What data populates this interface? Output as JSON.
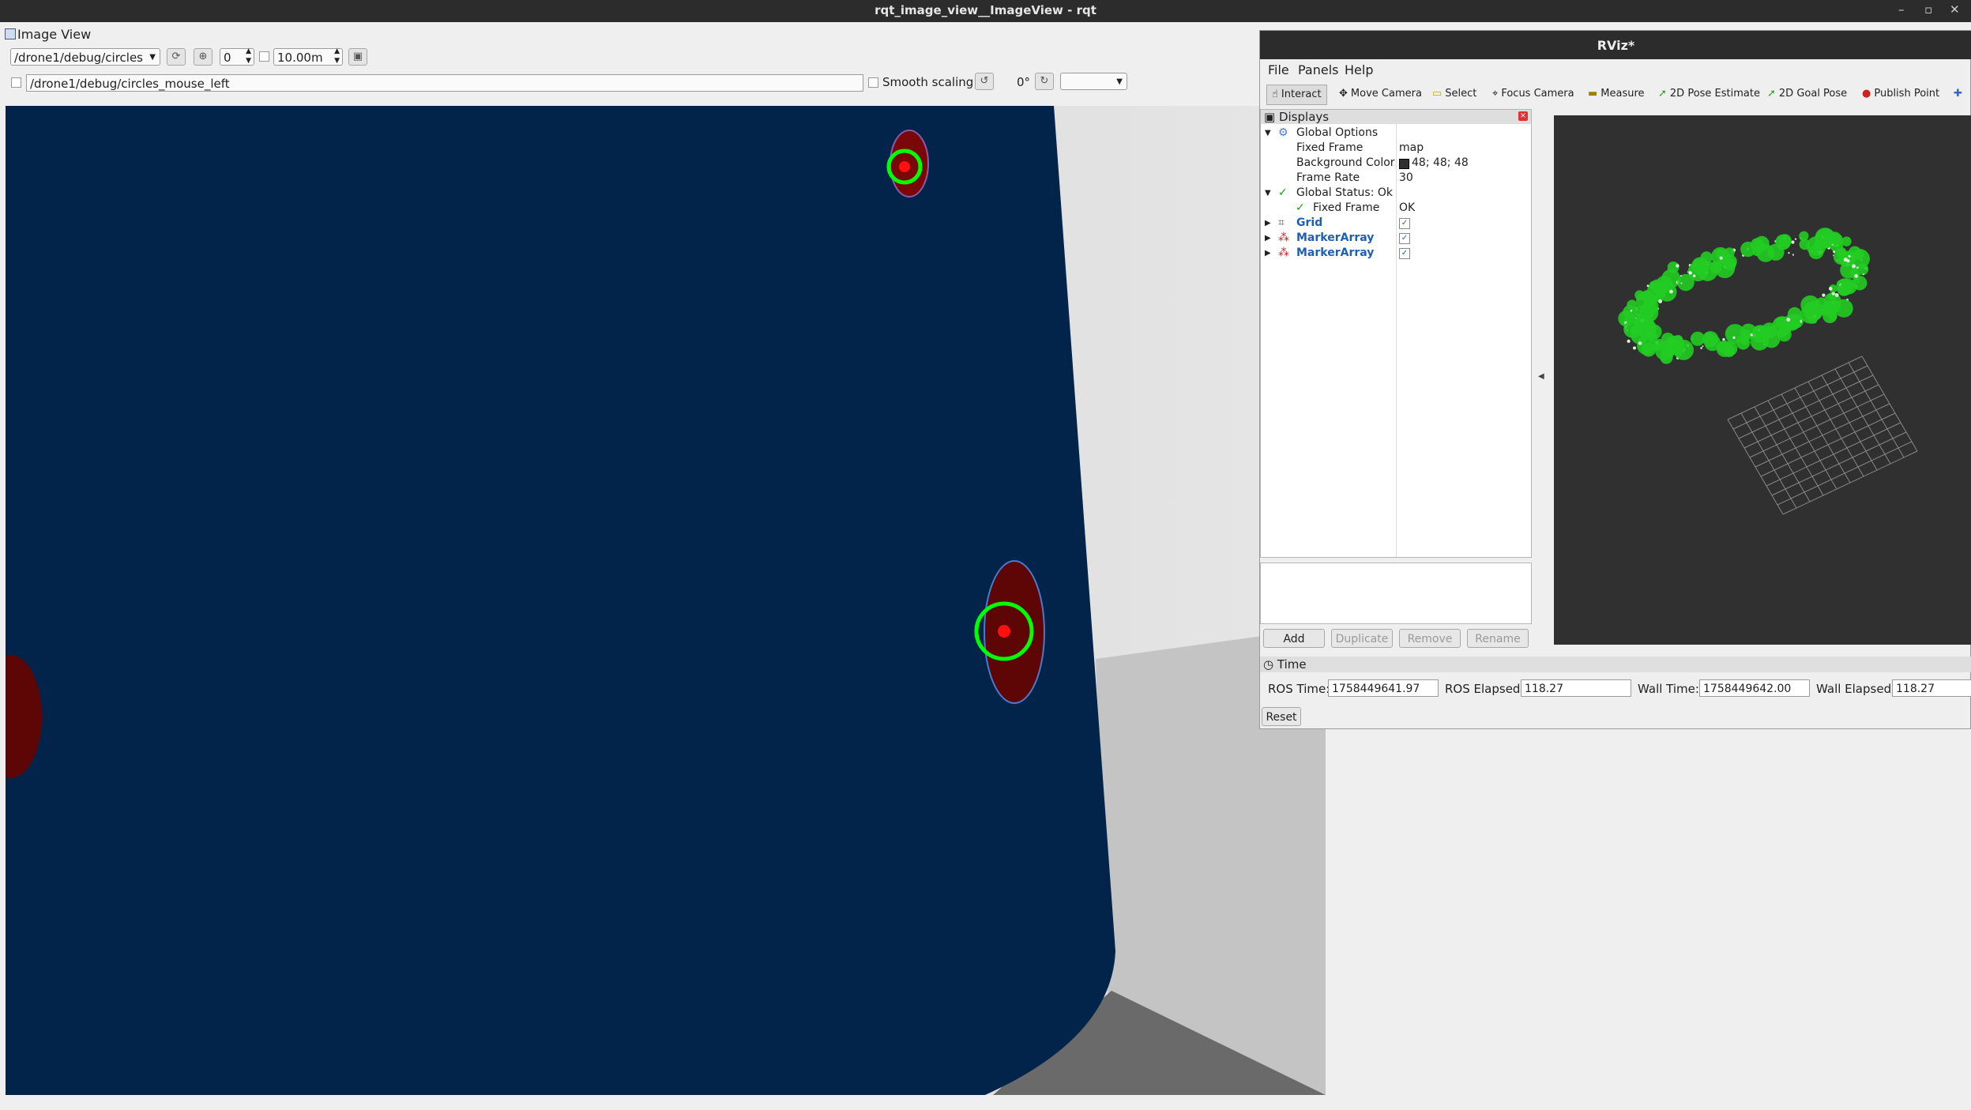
{
  "window": {
    "title": "rqt_image_view__ImageView - rqt"
  },
  "image_view": {
    "title": "Image View",
    "topic": "/drone1/debug/circles",
    "spin_value": "0",
    "max_range": "10.00m",
    "mouse_topic": "/drone1/debug/circles_mouse_left",
    "smooth_scaling_label": "Smooth scaling",
    "rotation": "0°"
  },
  "rviz": {
    "title": "RViz*",
    "menu": [
      "File",
      "Panels",
      "Help"
    ],
    "tools": [
      "Interact",
      "Move Camera",
      "Select",
      "Focus Camera",
      "Measure",
      "2D Pose Estimate",
      "2D Goal Pose",
      "Publish Point"
    ],
    "displays": {
      "header": "Displays",
      "rows": [
        {
          "label": "Global Options",
          "value": ""
        },
        {
          "label": "Fixed Frame",
          "value": "map"
        },
        {
          "label": "Background Color",
          "value": "48; 48; 48"
        },
        {
          "label": "Frame Rate",
          "value": "30"
        },
        {
          "label": "Global Status: Ok",
          "value": ""
        },
        {
          "label": "Fixed Frame",
          "value": "OK"
        },
        {
          "label": "Grid",
          "value": ""
        },
        {
          "label": "MarkerArray",
          "value": ""
        },
        {
          "label": "MarkerArray",
          "value": ""
        }
      ]
    },
    "panel_buttons": [
      "Add",
      "Duplicate",
      "Remove",
      "Rename"
    ],
    "time": {
      "header": "Time",
      "ros_time_label": "ROS Time:",
      "ros_time": "1758449641.97",
      "ros_elapsed_label": "ROS Elapsed:",
      "ros_elapsed": "118.27",
      "wall_time_label": "Wall Time:",
      "wall_time": "1758449642.00",
      "wall_elapsed_label": "Wall Elapsed:",
      "wall_elapsed": "118.27",
      "reset_label": "Reset"
    },
    "colors": {
      "background": "#303030",
      "markers": "#22cc22"
    }
  }
}
